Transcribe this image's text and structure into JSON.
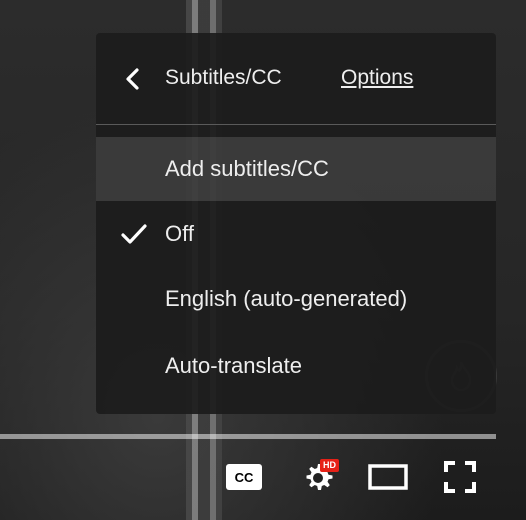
{
  "menu": {
    "title": "Subtitles/CC",
    "options_label": "Options",
    "items": [
      {
        "label": "Add subtitles/CC",
        "highlighted": true,
        "checked": false
      },
      {
        "label": "Off",
        "highlighted": false,
        "checked": true
      },
      {
        "label": "English (auto-generated)",
        "highlighted": false,
        "checked": false
      },
      {
        "label": "Auto-translate",
        "highlighted": false,
        "checked": false
      }
    ]
  },
  "controls": {
    "cc_label": "CC",
    "hd_badge": "HD",
    "icons": [
      "subtitles-cc-icon",
      "settings-gear-icon",
      "theater-mode-icon",
      "fullscreen-icon"
    ]
  },
  "colors": {
    "menu_bg": "#1c1c1c",
    "text": "#eeeeee",
    "hd_badge": "#e62117"
  }
}
